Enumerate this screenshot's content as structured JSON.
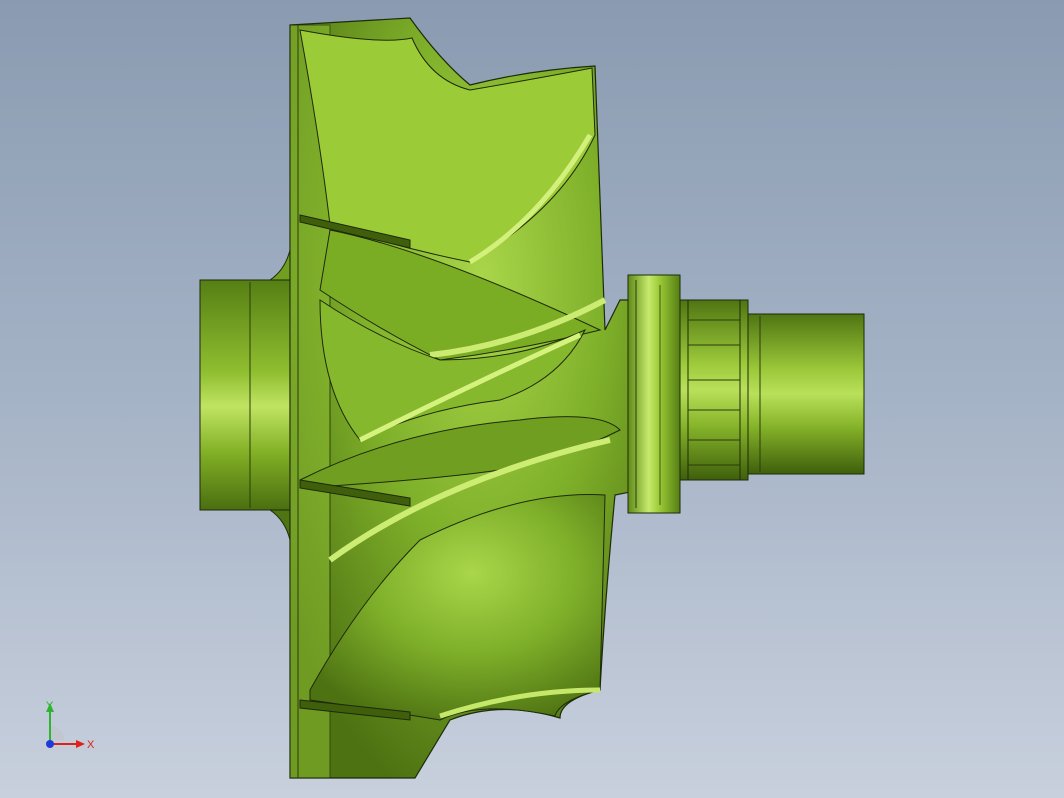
{
  "viewport": {
    "background_top": "#8a9bb1",
    "background_bottom": "#c8d0dd"
  },
  "model": {
    "part_color": "#7fb02a",
    "part_highlight": "#c9ec6a",
    "part_shadow": "#4b6e12",
    "edge_color": "#1e2a0a"
  },
  "triad": {
    "x_label": "X",
    "y_label": "Y",
    "x_color": "#e0201a",
    "y_color": "#2fb42f",
    "z_color": "#1f3ad8"
  }
}
